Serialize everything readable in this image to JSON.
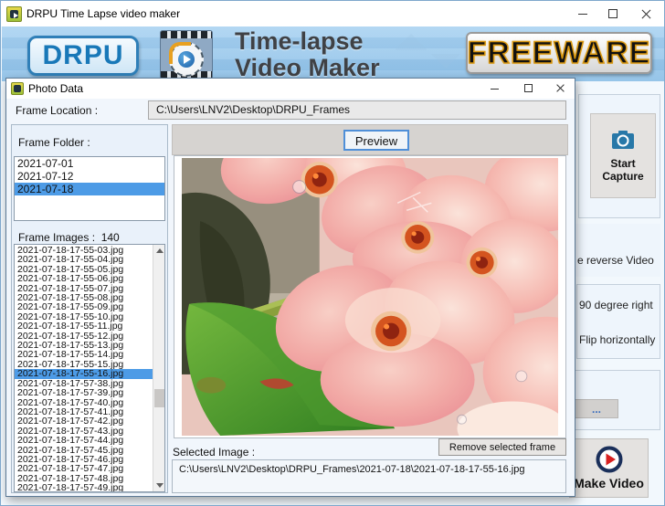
{
  "window": {
    "title": "DRPU Time Lapse video maker"
  },
  "banner": {
    "logo_text": "DRPU",
    "title_line1": "Time-lapse",
    "title_line2": "Video Maker",
    "freeware_badge": "FREEWARE"
  },
  "right_panel": {
    "start_capture_label": "Start Capture",
    "reverse_video_fragment": "e reverse Video",
    "rotate_fragment": "90 degree right",
    "flip_fragment": "Flip horizontally",
    "browse_button_label": "...",
    "make_video_label": "Make Video"
  },
  "dialog": {
    "title": "Photo Data",
    "frame_location_label": "Frame Location :",
    "frame_location_value": "C:\\Users\\LNV2\\Desktop\\DRPU_Frames",
    "frame_folder_label": "Frame Folder :",
    "folders": [
      "2021-07-01",
      "2021-07-12",
      "2021-07-18"
    ],
    "selected_folder": "2021-07-18",
    "frame_images_label": "Frame Images :",
    "frame_images_count": "140",
    "images": [
      "2021-07-18-17-55-03.jpg",
      "2021-07-18-17-55-04.jpg",
      "2021-07-18-17-55-05.jpg",
      "2021-07-18-17-55-06.jpg",
      "2021-07-18-17-55-07.jpg",
      "2021-07-18-17-55-08.jpg",
      "2021-07-18-17-55-09.jpg",
      "2021-07-18-17-55-10.jpg",
      "2021-07-18-17-55-11.jpg",
      "2021-07-18-17-55-12.jpg",
      "2021-07-18-17-55-13.jpg",
      "2021-07-18-17-55-14.jpg",
      "2021-07-18-17-55-15.jpg",
      "2021-07-18-17-55-16.jpg",
      "2021-07-18-17-57-38.jpg",
      "2021-07-18-17-57-39.jpg",
      "2021-07-18-17-57-40.jpg",
      "2021-07-18-17-57-41.jpg",
      "2021-07-18-17-57-42.jpg",
      "2021-07-18-17-57-43.jpg",
      "2021-07-18-17-57-44.jpg",
      "2021-07-18-17-57-45.jpg",
      "2021-07-18-17-57-46.jpg",
      "2021-07-18-17-57-47.jpg",
      "2021-07-18-17-57-48.jpg",
      "2021-07-18-17-57-49.jpg"
    ],
    "selected_image": "2021-07-18-17-55-16.jpg",
    "preview_button_label": "Preview",
    "selected_image_label": "Selected Image :",
    "remove_button_label": "Remove selected frame",
    "selected_image_path": "C:\\Users\\LNV2\\Desktop\\DRPU_Frames\\2021-07-18\\2021-07-18-17-55-16.jpg"
  },
  "colors": {
    "selection_blue": "#4d9be6",
    "camera_icon_blue": "#2878a8",
    "play_icon_navy": "#1a2f5a",
    "play_icon_red": "#d82020",
    "freeware_gold": "#d8960e",
    "drpu_blue": "#1878b8"
  }
}
